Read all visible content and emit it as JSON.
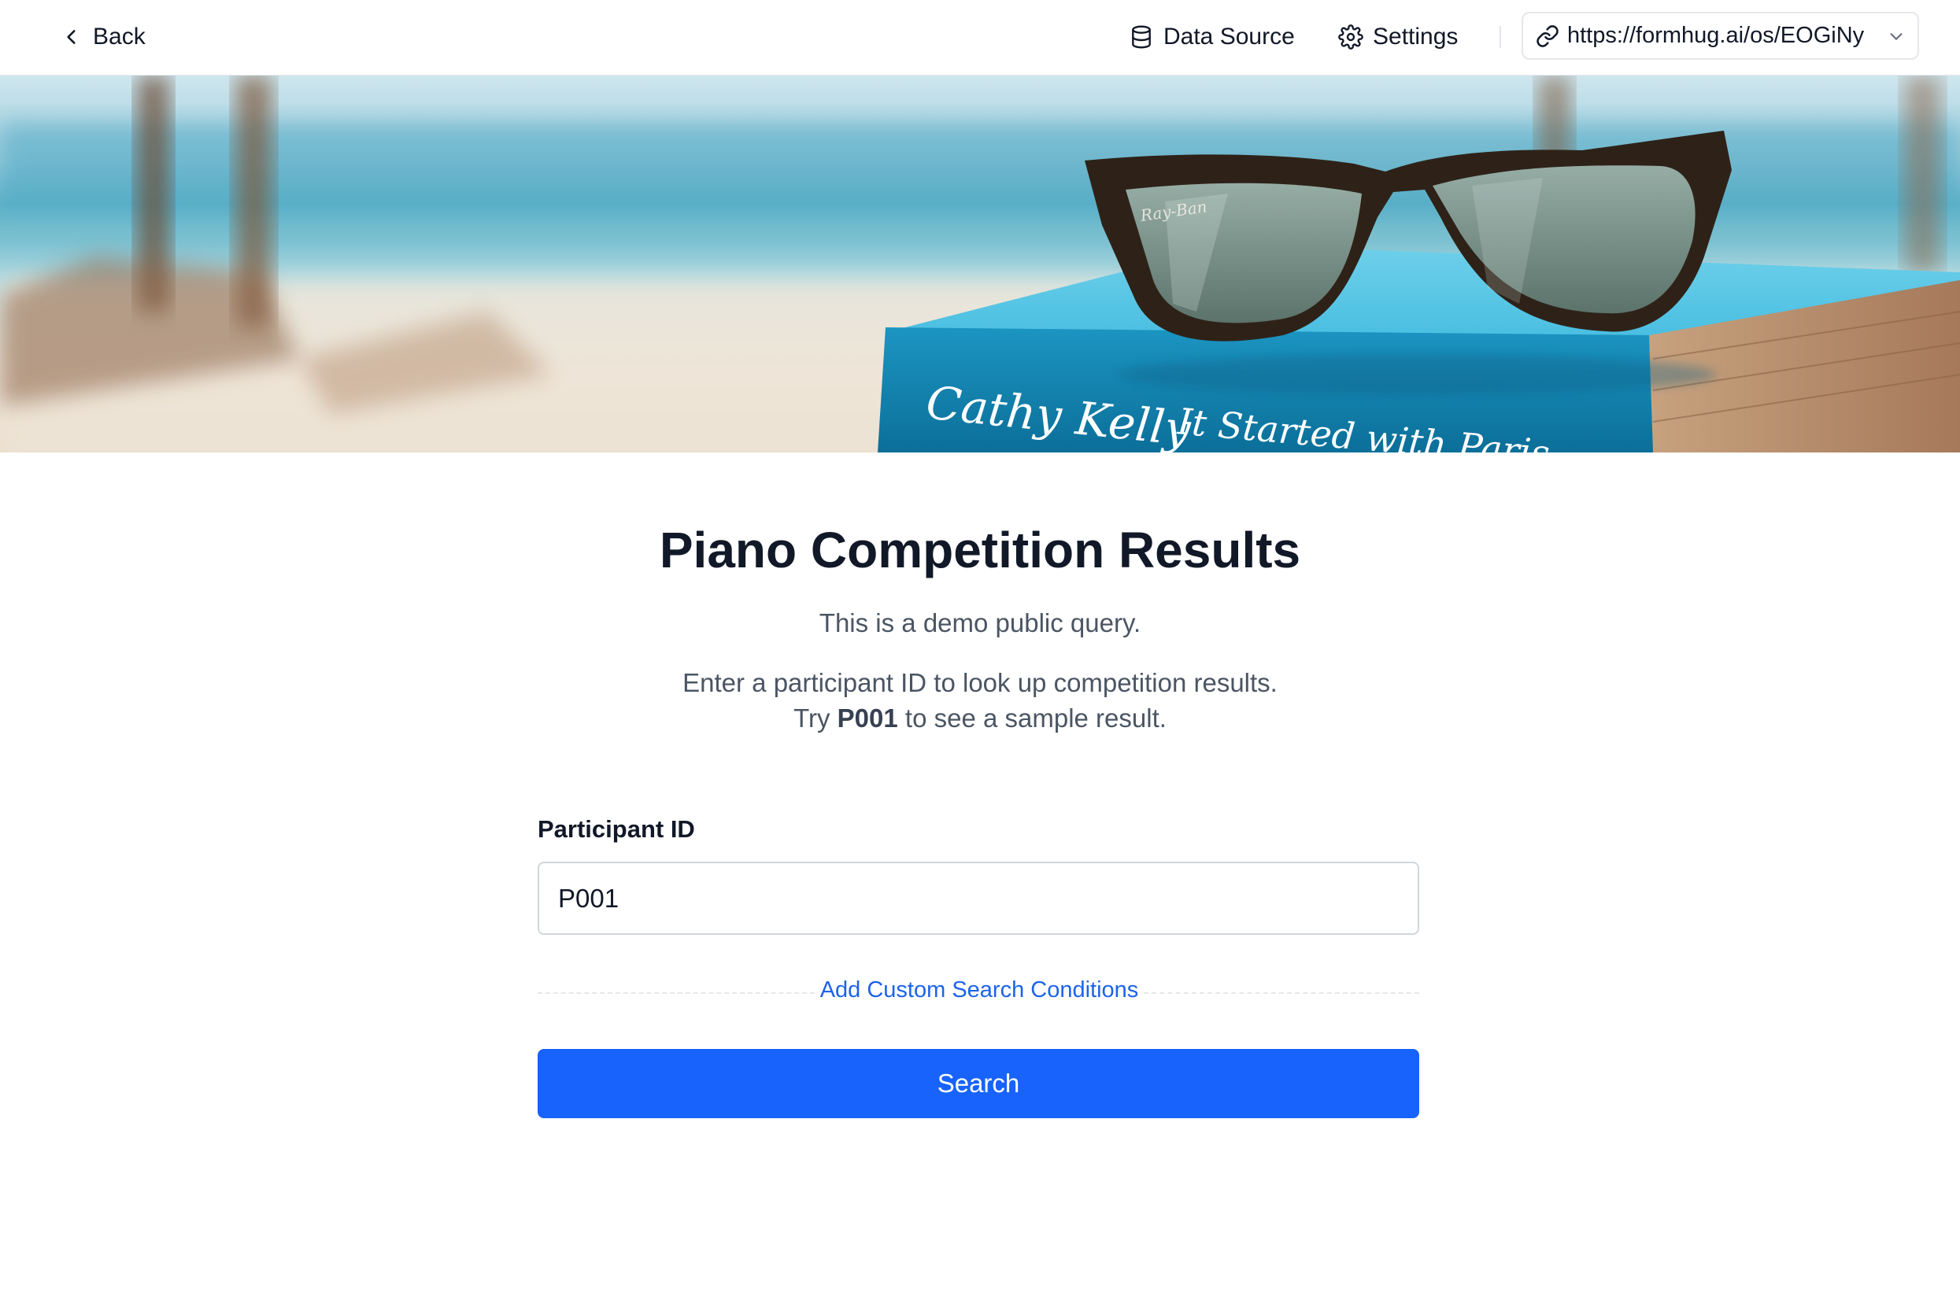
{
  "header": {
    "back_label": "Back",
    "data_source_label": "Data Source",
    "settings_label": "Settings",
    "share_url": "https://formhug.ai/os/EOGiNy"
  },
  "banner": {
    "book_author_text": "Cathy Kelly",
    "book_title_text": "It Started with Paris",
    "glasses_brand_text": "Ray-Ban"
  },
  "main": {
    "title": "Piano Competition Results",
    "description_line1": "This is a demo public query.",
    "description_line2": "Enter a participant ID to look up competition results.",
    "description_line3_prefix": "Try ",
    "description_line3_bold": "P001",
    "description_line3_suffix": " to see a sample result."
  },
  "form": {
    "field_label": "Participant ID",
    "field_value": "P001",
    "add_conditions_label": "Add Custom Search Conditions",
    "search_label": "Search"
  },
  "colors": {
    "primary": "#1763fb",
    "link": "#1d63ea",
    "text": "#111827",
    "muted": "#4b5563"
  },
  "icons": {
    "back": "chevron-left-icon",
    "data_source": "database-icon",
    "settings": "gear-icon",
    "share": "link-icon",
    "dropdown": "chevron-down-icon"
  }
}
